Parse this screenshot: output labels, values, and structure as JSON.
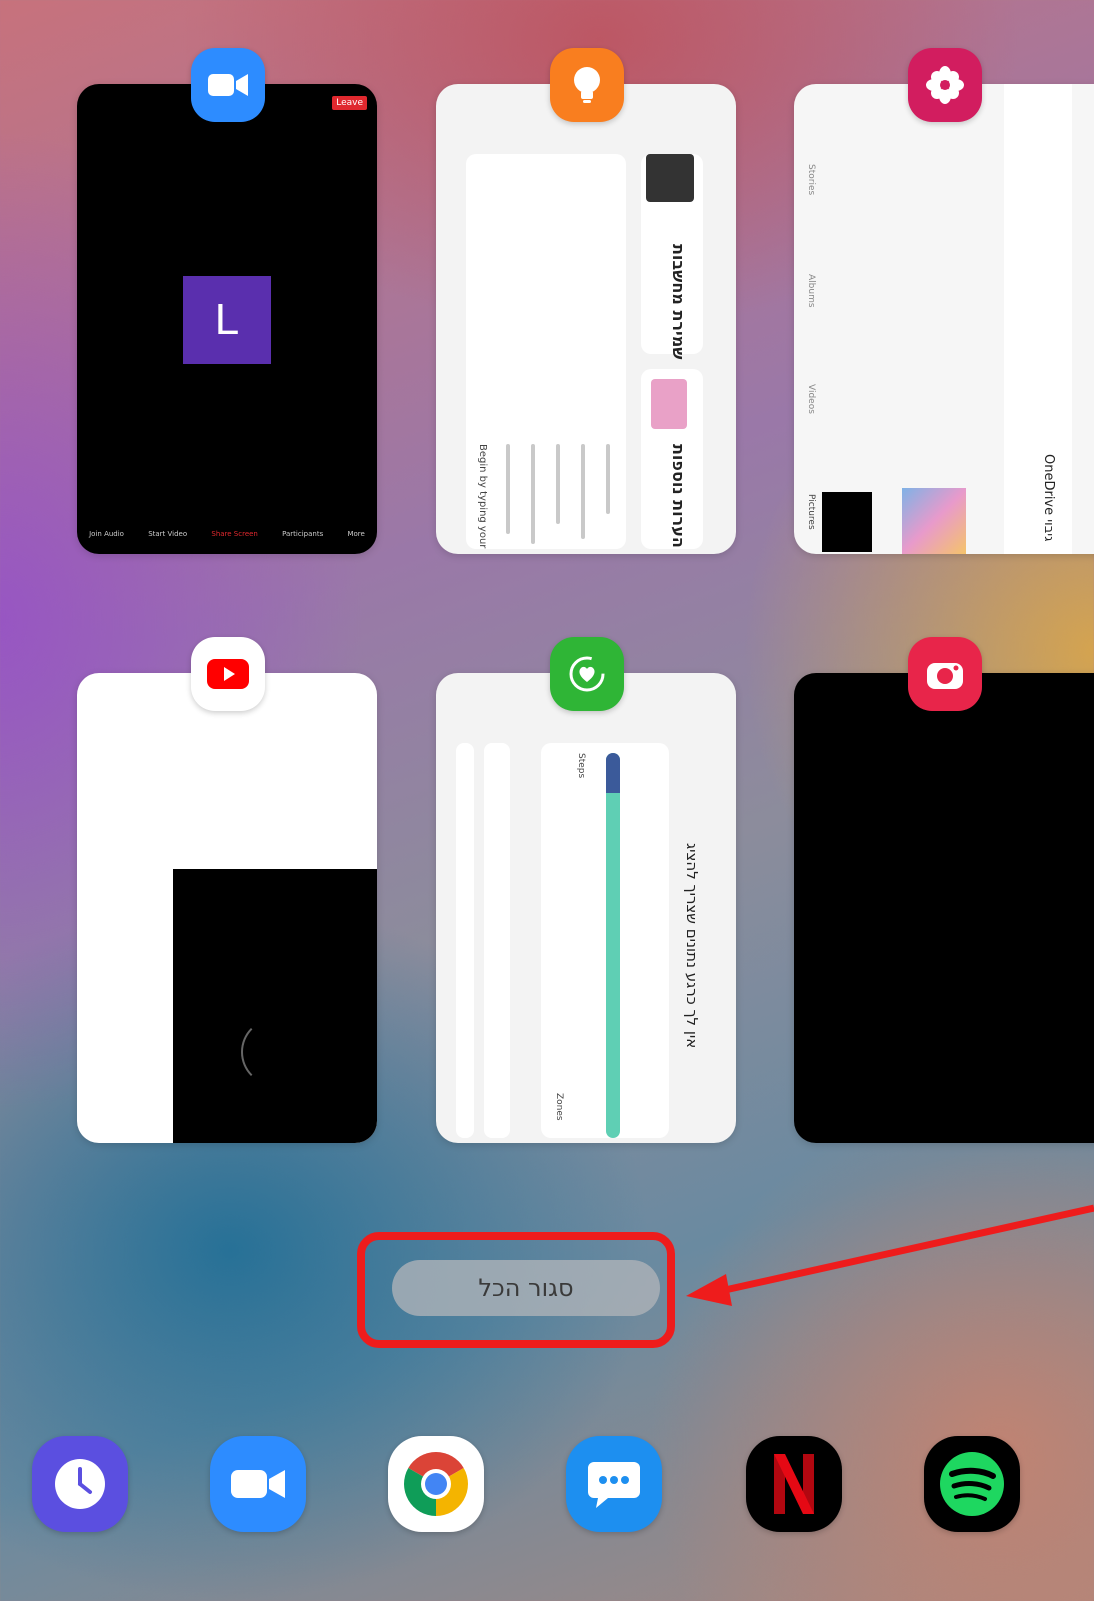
{
  "close_all": {
    "label": "סגור הכל"
  },
  "zoom_card": {
    "avatar_letter": "L",
    "leave_label": "Leave",
    "controls": [
      "Join Audio",
      "Start Video",
      "Share Screen",
      "Participants",
      "More"
    ]
  },
  "notes_card": {
    "heading_1": "שמירת מחשבות",
    "heading_2": "הערות נוספות",
    "side_text": "Begin by typing your"
  },
  "gallery_card": {
    "tabs": [
      "Pictures",
      "Videos",
      "Albums",
      "Stories"
    ],
    "header": "OneDrive גיבוי"
  },
  "health_card": {
    "heading": "אין לך כרגע נתונים שצריך להציג",
    "steps_label": "Steps",
    "zones_label": "Zones"
  },
  "recent_apps": [
    {
      "name": "Zoom",
      "icon": "zoom-icon",
      "color": "#2d8cff"
    },
    {
      "name": "Notes",
      "icon": "lightbulb-icon",
      "color": "#f97e1f"
    },
    {
      "name": "Gallery",
      "icon": "flower-icon",
      "color": "#d21d5f"
    },
    {
      "name": "YouTube",
      "icon": "youtube-icon",
      "color": "#ff0000"
    },
    {
      "name": "Health",
      "icon": "heart-icon",
      "color": "#2fb536"
    },
    {
      "name": "Camera",
      "icon": "camera-icon",
      "color": "#e8254a"
    }
  ],
  "dock": [
    {
      "name": "Clock",
      "icon": "clock-icon",
      "color": "#5b4fe0"
    },
    {
      "name": "Zoom",
      "icon": "zoom-icon",
      "color": "#2d8cff"
    },
    {
      "name": "Chrome",
      "icon": "chrome-icon",
      "color": "#ffffff"
    },
    {
      "name": "Messages",
      "icon": "message-icon",
      "color": "#1d8ff0"
    },
    {
      "name": "Netflix",
      "icon": "netflix-icon",
      "color": "#000000"
    },
    {
      "name": "Spotify",
      "icon": "spotify-icon",
      "color": "#000000"
    }
  ],
  "accent_colors": {
    "highlight": "#ee1c1c"
  }
}
